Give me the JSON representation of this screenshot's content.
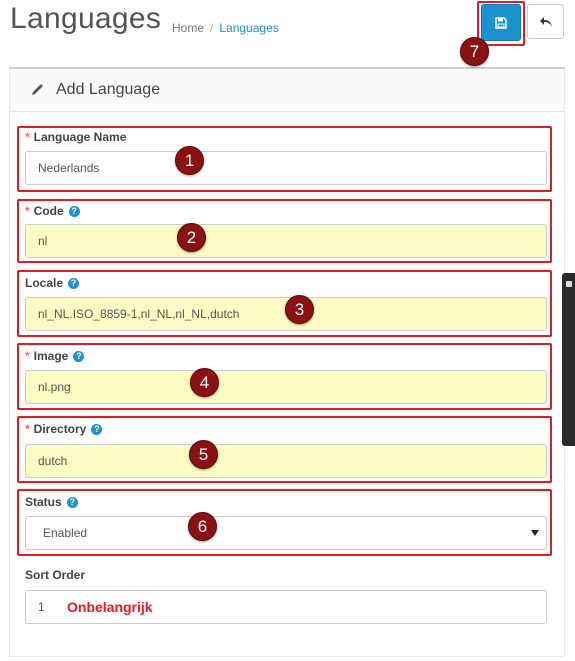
{
  "header": {
    "title": "Languages",
    "breadcrumb": [
      "Home",
      "Languages"
    ],
    "save_button": {
      "icon": "floppy-disk-icon",
      "color": "#1e91cf"
    },
    "back_button": {
      "icon": "reply-arrow-icon"
    }
  },
  "panel": {
    "icon": "pencil-icon",
    "title": "Add Language"
  },
  "form": {
    "language_name": {
      "label": "Language Name",
      "required": true,
      "value": "Nederlands"
    },
    "code": {
      "label": "Code",
      "required": true,
      "help": "?",
      "value": "nl"
    },
    "locale": {
      "label": "Locale",
      "required": false,
      "help": "?",
      "value": "nl_NL.ISO_8859-1,nl_NL,nl_NL,dutch"
    },
    "image": {
      "label": "Image",
      "required": true,
      "help": "?",
      "value": "nl.png"
    },
    "directory": {
      "label": "Directory",
      "required": true,
      "help": "?",
      "value": "dutch"
    },
    "status": {
      "label": "Status",
      "help": "?",
      "value": "Enabled"
    },
    "sort_order": {
      "label": "Sort Order",
      "value": "1"
    }
  },
  "required_mark": "*",
  "markers": [
    "1",
    "2",
    "3",
    "4",
    "5",
    "6",
    "7"
  ],
  "annotation_text": "Onbelangrijk",
  "colors": {
    "highlight": "#e31b23",
    "marker": "#8b1212",
    "input_autofill": "#fafcc4",
    "accent": "#1e91cf"
  }
}
